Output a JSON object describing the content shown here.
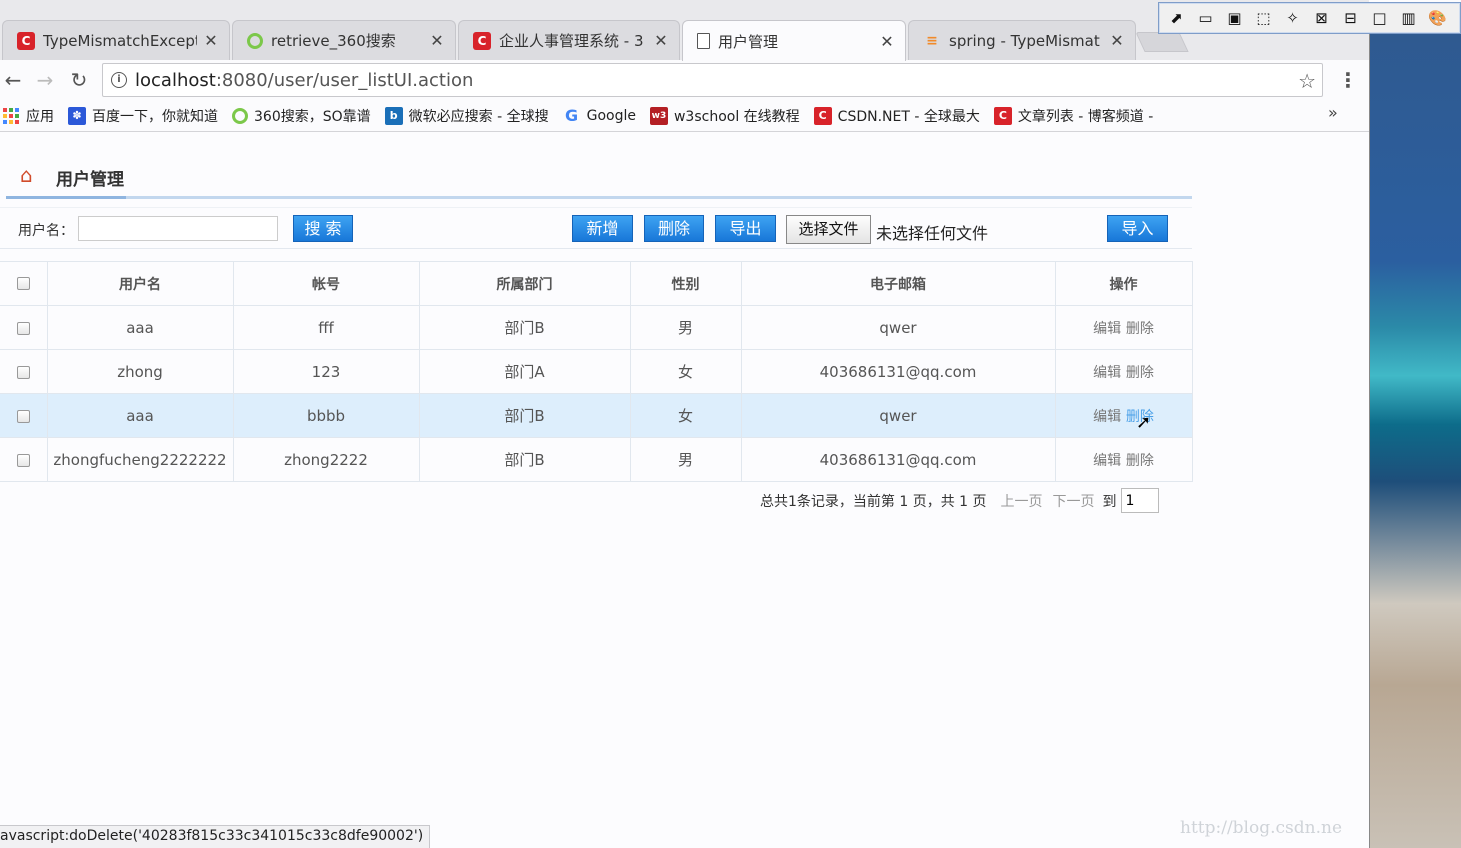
{
  "tabs": [
    {
      "title": "TypeMismatchExcept",
      "favicon": "csdn-icon"
    },
    {
      "title": "retrieve_360搜索",
      "favicon": "360-icon"
    },
    {
      "title": "企业人事管理系统 - 3",
      "favicon": "csdn-icon"
    },
    {
      "title": "用户管理",
      "favicon": "page-icon",
      "active": true
    },
    {
      "title": "spring - TypeMismat",
      "favicon": "stackoverflow-icon"
    }
  ],
  "address": {
    "host": "localhost",
    "rest": ":8080/user/user_listUI.action"
  },
  "bookmarks": [
    {
      "label": "应用",
      "icon": "apps-icon"
    },
    {
      "label": "百度一下，你就知道",
      "icon": "baidu-icon"
    },
    {
      "label": "360搜索，SO靠谱",
      "icon": "360-icon"
    },
    {
      "label": "微软必应搜索 - 全球搜",
      "icon": "bing-icon"
    },
    {
      "label": "Google",
      "icon": "google-icon"
    },
    {
      "label": "w3school 在线教程",
      "icon": "w3school-icon"
    },
    {
      "label": "CSDN.NET - 全球最大",
      "icon": "csdn-icon"
    },
    {
      "label": "文章列表 - 博客频道 -",
      "icon": "csdn-icon"
    }
  ],
  "bookmarks_more": "»",
  "page": {
    "title": "用户管理"
  },
  "search": {
    "label": "用户名：",
    "value": "",
    "button": "搜 索"
  },
  "actions": {
    "add": "新增",
    "delete": "删除",
    "export": "导出",
    "choose_file": "选择文件",
    "file_status": "未选择任何文件",
    "import": "导入"
  },
  "table": {
    "headers": [
      "用户名",
      "帐号",
      "所属部门",
      "性别",
      "电子邮箱",
      "操作"
    ],
    "rows": [
      {
        "username": "aaa",
        "account": "fff",
        "dept": "部门B",
        "gender": "男",
        "email": "qwer",
        "edit": "编辑",
        "del": "删除"
      },
      {
        "username": "zhong",
        "account": "123",
        "dept": "部门A",
        "gender": "女",
        "email": "403686131@qq.com",
        "edit": "编辑",
        "del": "删除"
      },
      {
        "username": "aaa",
        "account": "bbbb",
        "dept": "部门B",
        "gender": "女",
        "email": "qwer",
        "edit": "编辑",
        "del": "删除"
      },
      {
        "username": "zhongfucheng2222222",
        "account": "zhong2222",
        "dept": "部门B",
        "gender": "男",
        "email": "403686131@qq.com",
        "edit": "编辑",
        "del": "删除"
      }
    ]
  },
  "pager": {
    "summary": "总共1条记录，当前第 1 页，共 1 页",
    "prev": "上一页",
    "next": "下一页",
    "goto": "到",
    "page_value": "1"
  },
  "status_bar": "avascript:doDelete('40283f815c33c341015c33c8dfe90002')",
  "watermark": "http://blog.csdn.ne",
  "colors": {
    "primary_button": "#1877d8",
    "row_hover": "#ddeefc",
    "header_underline": "#8fb5e0",
    "home_icon": "#d14b2b"
  }
}
